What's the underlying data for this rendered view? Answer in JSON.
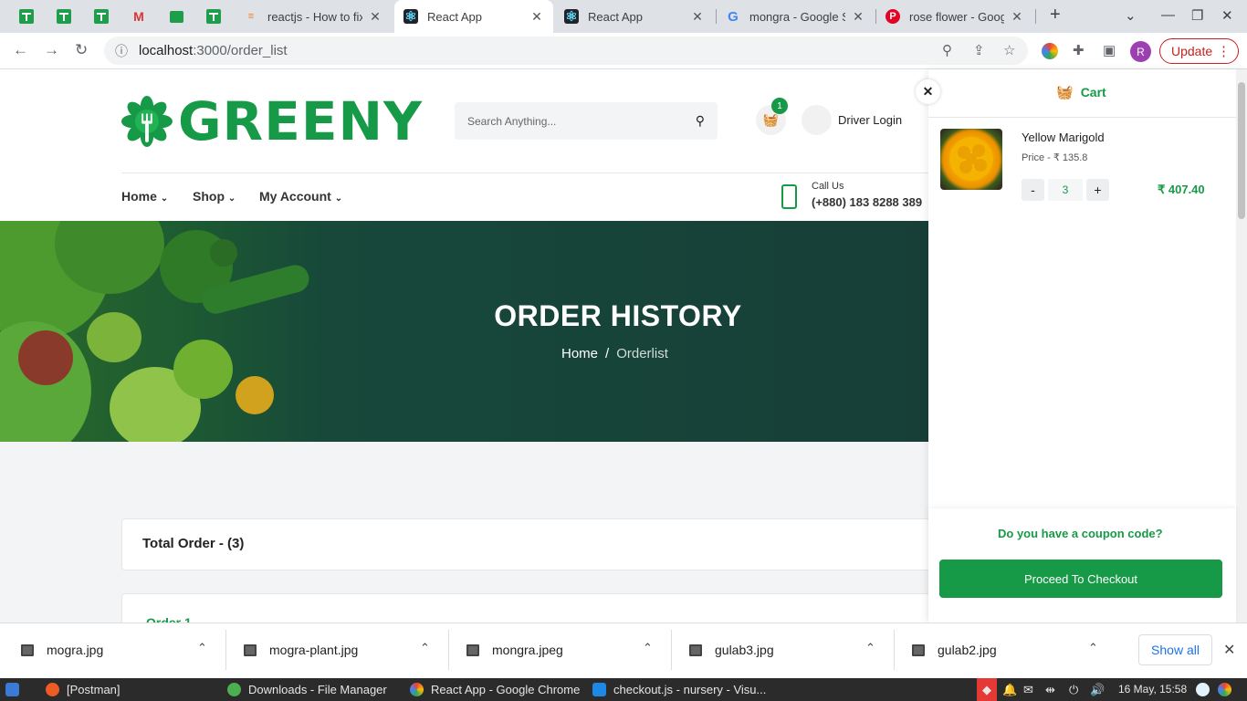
{
  "browser": {
    "tabs": [
      {
        "title": "reactjs - How to fix",
        "icon": "stackoverflow-icon"
      },
      {
        "title": "React App",
        "icon": "react-icon",
        "active": true
      },
      {
        "title": "React App",
        "icon": "react-icon"
      },
      {
        "title": "mongra - Google S",
        "icon": "google-icon"
      },
      {
        "title": "rose flower - Goog",
        "icon": "pinterest-icon"
      }
    ],
    "url_host": "localhost",
    "url_path": ":3000/order_list",
    "avatar_letter": "R",
    "update_label": "Update"
  },
  "site": {
    "logo_text": "GREENY",
    "search_placeholder": "Search Anything...",
    "cart_count": "1",
    "driver_login": "Driver Login",
    "menu": [
      "Home",
      "Shop",
      "My Account"
    ],
    "call_label": "Call Us",
    "call_number": "(+880) 183 8288 389",
    "hero_title": "ORDER HISTORY",
    "breadcrumb_home": "Home",
    "breadcrumb_sep": "/",
    "breadcrumb_current": "Orderlist",
    "total_order": "Total Order - (3)",
    "order_1": "Order 1"
  },
  "cart": {
    "title": "Cart",
    "item": {
      "name": "Yellow Marigold",
      "price": "Price - ₹ 135.8",
      "qty": "3",
      "total": "₹ 407.40"
    },
    "coupon": "Do you have a coupon code?",
    "checkout": "Proceed To Checkout"
  },
  "downloads": {
    "items": [
      "mogra.jpg",
      "mogra-plant.jpg",
      "mongra.jpeg",
      "gulab3.jpg",
      "gulab2.jpg"
    ],
    "show_all": "Show all"
  },
  "taskbar": {
    "items": [
      "[Postman]",
      "Downloads - File Manager",
      "React App - Google Chrome",
      "checkout.js - nursery - Visu..."
    ],
    "clock": "16 May, 15:58"
  },
  "colors": {
    "brand_green": "#179a47",
    "hero_dark": "#173f38"
  }
}
